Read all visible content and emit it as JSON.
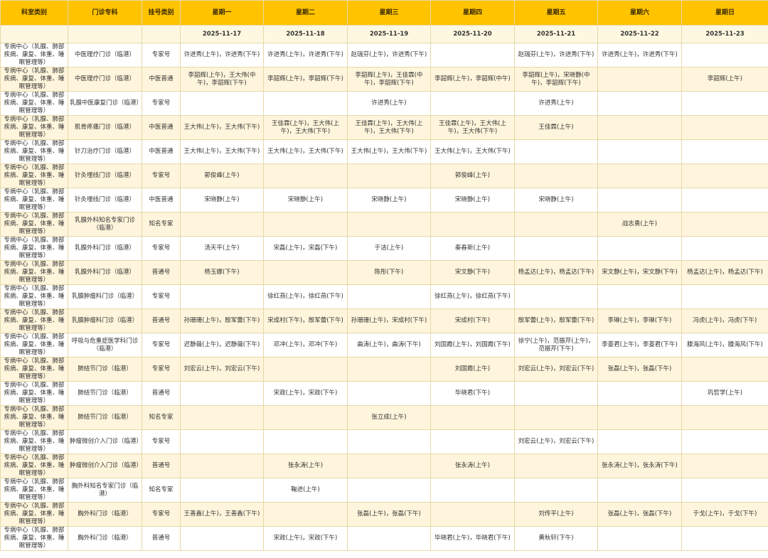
{
  "headers": [
    "科室类别",
    "门诊专科",
    "挂号类别",
    "星期一",
    "星期二",
    "星期三",
    "星期四",
    "星期五",
    "星期六",
    "星期日"
  ],
  "dates": [
    "",
    "",
    "",
    "2025-11-17",
    "2025-11-18",
    "2025-11-19",
    "2025-11-20",
    "2025-11-21",
    "2025-11-22",
    "2025-11-23"
  ],
  "rows": [
    {
      "cells": [
        "专病中心（乳腺、肺部疾病、康复、体重、睡眠管理等）",
        "中医理疗门诊（临港）",
        "专家号",
        "许进秀(上午)，许进秀(下午)",
        "许进秀(上午)，许进秀(下午)",
        "赵瑞芬(上午)，许进秀(下午)",
        "",
        "赵瑞芬(上午)，许进秀(下午)",
        "许进秀(上午)，许进秀(下午)",
        ""
      ]
    },
    {
      "cells": [
        "专病中心（乳腺、肺部疾病、康复、体重、睡眠管理等）",
        "中医理疗门诊（临港）",
        "中医普通",
        "李韶辉(上午)，王大伟(中午)，李韶辉(下午)",
        "李韶辉(上午)，李韶辉(下午)",
        "李韶辉(上午)，王佳霖(中午)，李韶辉(下午)",
        "李韶辉(上午)，李韶辉(中午)",
        "李韶辉(上午)，宋晓静(中午)，李韶辉(下午)",
        "",
        "李韶辉(上午)"
      ]
    },
    {
      "cells": [
        "专病中心（乳腺、肺部疾病、康复、体重、睡眠管理等）",
        "乳腺中医康复门诊（临港）",
        "专家号",
        "",
        "",
        "许进秀(上午)",
        "",
        "许进秀(上午)",
        "",
        ""
      ]
    },
    {
      "cells": [
        "专病中心（乳腺、肺部疾病、康复、体重、睡眠管理等）",
        "肌骨疼痛门诊（临港）",
        "中医普通",
        "王大伟(上午)，王大伟(下午)",
        "王佳霖(上午)，王大伟(上午)，王大伟(下午)",
        "王佳霖(上午)，王大伟(上午)，王大伟(下午)",
        "王佳霖(上午)，王大伟(上午)，王大伟(下午)",
        "王佳霖(上午)",
        "",
        ""
      ]
    },
    {
      "cells": [
        "专病中心（乳腺、肺部疾病、康复、体重、睡眠管理等）",
        "针刀治疗门诊（临港）",
        "中医普通",
        "王大伟(上午)，王大伟(下午)",
        "王大伟(上午)，王大伟(下午)",
        "王大伟(上午)，王大伟(下午)",
        "王大伟(上午)，王大伟(下午)",
        "",
        "",
        ""
      ]
    },
    {
      "cells": [
        "专病中心（乳腺、肺部疾病、康复、体重、睡眠管理等）",
        "针灸埋线门诊（临港）",
        "专家号",
        "郭俊峰(上午)",
        "",
        "",
        "郭俊峰(上午)",
        "",
        "",
        ""
      ]
    },
    {
      "cells": [
        "专病中心（乳腺、肺部疾病、康复、体重、睡眠管理等）",
        "针灸埋线门诊（临港）",
        "中医普通",
        "宋晓静(上午)",
        "宋晓静(上午)",
        "宋晓静(上午)",
        "宋晓静(上午)",
        "宋晓静(上午)",
        "",
        ""
      ]
    },
    {
      "cells": [
        "专病中心（乳腺、肺部疾病、康复、体重、睡眠管理等）",
        "乳腺外科知名专家门诊（临港）",
        "知名专家",
        "",
        "",
        "",
        "",
        "",
        "战志勇(上午)",
        ""
      ]
    },
    {
      "cells": [
        "专病中心（乳腺、肺部疾病、康复、体重、睡眠管理等）",
        "乳腺外科门诊（临港）",
        "专家号",
        "汤天平(上午)",
        "宋磊(上午)，宋磊(下午)",
        "于洁(上午)",
        "秦春新(上午)",
        "",
        "",
        ""
      ]
    },
    {
      "cells": [
        "专病中心（乳腺、肺部疾病、康复、体重、睡眠管理等）",
        "乳腺外科门诊（临港）",
        "普通号",
        "杨玉娜(下午)",
        "",
        "陈彤(下午)",
        "宋文静(下午)",
        "杨孟达(上午)，杨孟达(下午)",
        "宋文静(上午)，宋文静(下午)",
        "杨孟达(上午)，杨孟达(下午)"
      ]
    },
    {
      "cells": [
        "专病中心（乳腺、肺部疾病、康复、体重、睡眠管理等）",
        "乳腺肿瘤科门诊（临港）",
        "专家号",
        "",
        "徐红燕(上午)，徐红燕(下午)",
        "",
        "徐红燕(上午)，徐红燕(下午)",
        "",
        "",
        ""
      ]
    },
    {
      "cells": [
        "专病中心（乳腺、肺部疾病、康复、体重、睡眠管理等）",
        "乳腺肿瘤科门诊（临港）",
        "普通号",
        "孙珊珊(上午)，殷军蕾(下午)",
        "宋成村(下午)，殷军蕾(下午)",
        "孙珊珊(上午)，宋成村(下午)",
        "宋成村(下午)",
        "殷军蕾(上午)，殷军蕾(下午)",
        "李琳(上午)，李琳(下午)",
        "冯虎(上午)，冯虎(下午)"
      ]
    },
    {
      "cells": [
        "专病中心（乳腺、肺部疾病、康复、体重、睡眠管理等）",
        "呼吸与危重症医学科门诊（临港）",
        "专家号",
        "迟静薇(上午)，迟静薇(下午)",
        "邓冲(上午)，邓冲(下午)",
        "曲涛(上午)，曲涛(下午)",
        "刘国霞(上午)，刘国霞(下午)",
        "徐宁(上午)，范振芹(上午)，范振芹(下午)",
        "李菱君(上午)，李菱君(下午)",
        "滕海风(上午)，滕海风(下午)"
      ]
    },
    {
      "cells": [
        "专病中心（乳腺、肺部疾病、康复、体重、睡眠管理等）",
        "肺结节门诊（临港）",
        "专家号",
        "刘宏云(上午)，刘宏云(下午)",
        "",
        "",
        "刘国霞(上午)",
        "刘宏云(上午)，刘宏云(下午)",
        "张磊(上午)，张磊(下午)",
        ""
      ]
    },
    {
      "cells": [
        "专病中心（乳腺、肺部疾病、康复、体重、睡眠管理等）",
        "肺结节门诊（临港）",
        "普通号",
        "",
        "宋政(上午)，宋政(下午)",
        "",
        "毕晓君(下午)",
        "",
        "",
        "巩哲学(上午)"
      ]
    },
    {
      "cells": [
        "专病中心（乳腺、肺部疾病、康复、体重、睡眠管理等）",
        "肺结节门诊（临港）",
        "知名专家",
        "",
        "",
        "张立成(上午)",
        "",
        "",
        "",
        ""
      ]
    },
    {
      "cells": [
        "专病中心（乳腺、肺部疾病、康复、体重、睡眠管理等）",
        "肿瘤微创介入门诊（临港）",
        "专家号",
        "",
        "",
        "",
        "",
        "刘宏云(上午)，刘宏云(下午)",
        "",
        ""
      ]
    },
    {
      "cells": [
        "专病中心（乳腺、肺部疾病、康复、体重、睡眠管理等）",
        "肿瘤微创介入门诊（临港）",
        "普通号",
        "",
        "张永涛(上午)",
        "",
        "张永涛(上午)",
        "",
        "张永涛(上午)，张永涛(下午)",
        ""
      ]
    },
    {
      "cells": [
        "专病中心（乳腺、肺部疾病、康复、体重、睡眠管理等）",
        "胸外科知名专家门诊（临港）",
        "知名专家",
        "",
        "鞠进(上午)",
        "",
        "",
        "",
        "",
        ""
      ]
    },
    {
      "cells": [
        "专病中心（乳腺、肺部疾病、康复、体重、睡眠管理等）",
        "胸外科门诊（临港）",
        "专家号",
        "王善鑫(上午)，王善鑫(下午)",
        "",
        "张磊(上午)，张磊(下午)",
        "",
        "刘传平(上午)",
        "张磊(上午)，张磊(下午)",
        "于戈(上午)，于戈(下午)"
      ]
    },
    {
      "cells": [
        "专病中心（乳腺、肺部疾病、康复、体重、睡眠管理等）",
        "胸外科门诊（临港）",
        "普通号",
        "",
        "宋政(上午)，宋政(下午)",
        "",
        "毕晓君(上午)，毕晓君(下午)",
        "黄秋轩(下午)",
        "",
        ""
      ]
    }
  ]
}
